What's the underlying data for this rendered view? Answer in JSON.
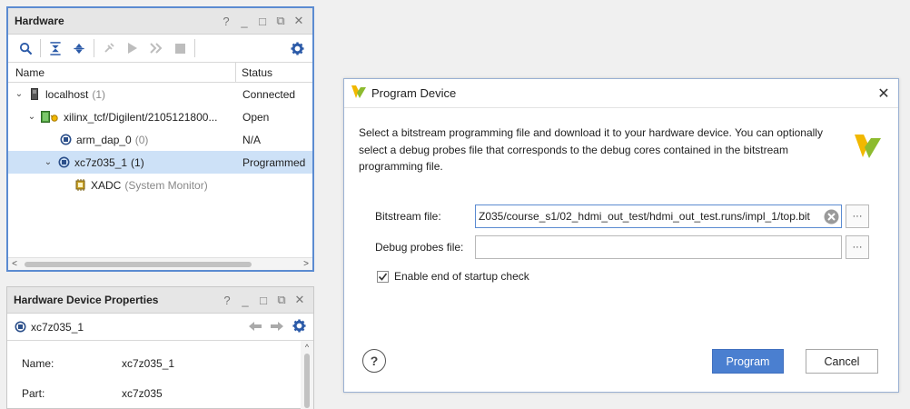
{
  "hardware_panel": {
    "title": "Hardware",
    "header_controls": [
      "?",
      "_",
      "□",
      "⧉",
      "✕"
    ],
    "toolbar_icons": [
      "search-icon",
      "collapse-all-icon",
      "expand-all-icon",
      "auto-connect-icon",
      "run-icon",
      "step-icon",
      "stop-icon",
      "gear-icon"
    ],
    "columns": {
      "name": "Name",
      "status": "Status"
    },
    "rows": [
      {
        "label": "localhost",
        "count": "(1)",
        "status": "Connected"
      },
      {
        "label": "xilinx_tcf/Digilent/2105121800...",
        "count": "",
        "status": "Open"
      },
      {
        "label": "arm_dap_0",
        "count": "(0)",
        "status": "N/A"
      },
      {
        "label": "xc7z035_1",
        "count": "(1)",
        "status": "Programmed"
      },
      {
        "label": "XADC",
        "count": "(System Monitor)",
        "status": ""
      }
    ]
  },
  "properties_panel": {
    "title": "Hardware Device Properties",
    "device": "xc7z035_1",
    "props": [
      {
        "label": "Name:",
        "value": "xc7z035_1"
      },
      {
        "label": "Part:",
        "value": "xc7z035"
      }
    ]
  },
  "dialog": {
    "title": "Program Device",
    "description_lines": [
      "Select a bitstream programming file and download it to your hardware device. You can optionally",
      "select a debug probes file that corresponds to the debug cores contained in the bitstream",
      "programming file."
    ],
    "bitstream_label": "Bitstream file:",
    "bitstream_value": "Z035/course_s1/02_hdmi_out_test/hdmi_out_test.runs/impl_1/top.bit",
    "debug_label": "Debug probes file:",
    "debug_value": "",
    "browse_label": "···",
    "checkbox_label": "Enable end of startup check",
    "checkbox_checked": true,
    "help_label": "?",
    "program_button": "Program",
    "cancel_button": "Cancel"
  },
  "colors": {
    "accent": "#4a7fd0",
    "selection": "#cde1f7",
    "panel_border": "#5b8bd1",
    "vivado_green": "#8dbb2f",
    "vivado_yellow": "#f1b800"
  }
}
